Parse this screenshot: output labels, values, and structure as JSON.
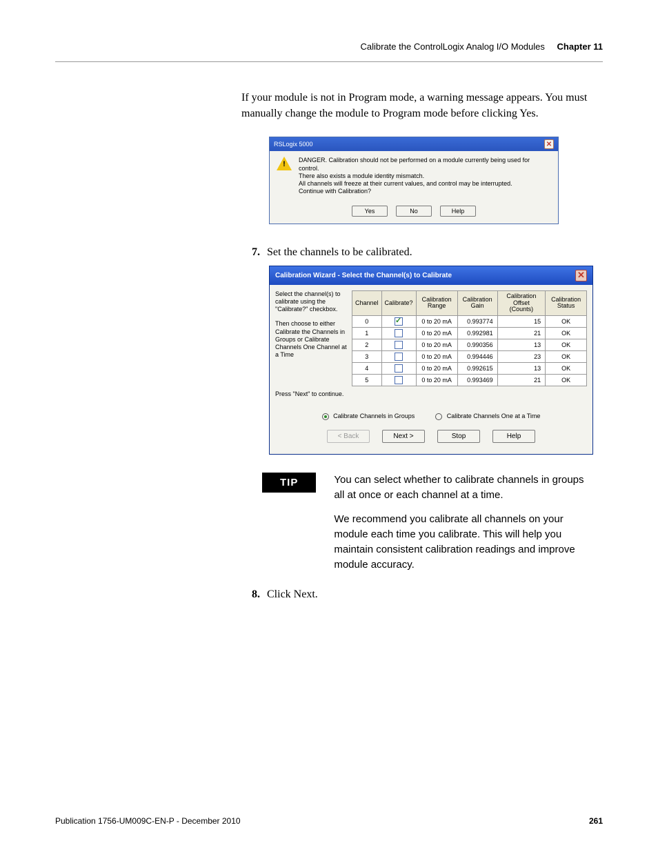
{
  "header": {
    "breadcrumb": "Calibrate the ControlLogix Analog I/O Modules",
    "chapter": "Chapter 11"
  },
  "intro_paragraph": "If your module is not in Program mode, a warning message appears. You must manually change the module to Program mode before clicking Yes.",
  "warn_dialog": {
    "title": "RSLogix 5000",
    "line1": "DANGER. Calibration should not be performed on a module currently being used for control.",
    "line2": "There also exists a module identity mismatch.",
    "line3": "All channels will freeze at their current values, and control may be interrupted.",
    "line4": "Continue with Calibration?",
    "btn_yes": "Yes",
    "btn_no": "No",
    "btn_help": "Help"
  },
  "step7": {
    "num": "7.",
    "text": "Set the channels to be calibrated."
  },
  "cal_dialog": {
    "title": "Calibration Wizard - Select the Channel(s) to Calibrate",
    "instr1": "Select the channel(s) to calibrate using the \"Calibrate?\" checkbox.",
    "instr2": "Then choose to either Calibrate the Channels in Groups or Calibrate Channels One Channel at a Time",
    "press": "Press \"Next\" to continue.",
    "headers": {
      "channel": "Channel",
      "calibrate": "Calibrate?",
      "range": "Calibration Range",
      "gain": "Calibration Gain",
      "offset": "Calibration Offset (Counts)",
      "status": "Calibration Status"
    },
    "rows": [
      {
        "ch": "0",
        "on": true,
        "range": "0 to 20 mA",
        "gain": "0.993774",
        "offset": "15",
        "status": "OK"
      },
      {
        "ch": "1",
        "on": false,
        "range": "0 to 20 mA",
        "gain": "0.992981",
        "offset": "21",
        "status": "OK"
      },
      {
        "ch": "2",
        "on": false,
        "range": "0 to 20 mA",
        "gain": "0.990356",
        "offset": "13",
        "status": "OK"
      },
      {
        "ch": "3",
        "on": false,
        "range": "0 to 20 mA",
        "gain": "0.994446",
        "offset": "23",
        "status": "OK"
      },
      {
        "ch": "4",
        "on": false,
        "range": "0 to 20 mA",
        "gain": "0.992615",
        "offset": "13",
        "status": "OK"
      },
      {
        "ch": "5",
        "on": false,
        "range": "0 to 20 mA",
        "gain": "0.993469",
        "offset": "21",
        "status": "OK"
      }
    ],
    "radio_groups": "Calibrate Channels in Groups",
    "radio_one": "Calibrate Channels One at a Time",
    "btn_back": "< Back",
    "btn_next": "Next >",
    "btn_stop": "Stop",
    "btn_help": "Help"
  },
  "tip": {
    "label": "TIP",
    "p1": "You can select whether to calibrate channels in groups all at once or each channel at a time.",
    "p2": "We  recommend you calibrate all channels on your module each time you calibrate. This will help you maintain consistent calibration readings and improve module accuracy."
  },
  "step8": {
    "num": "8.",
    "text": "Click Next."
  },
  "footer": {
    "pub": "Publication 1756-UM009C-EN-P - December 2010",
    "page": "261"
  }
}
